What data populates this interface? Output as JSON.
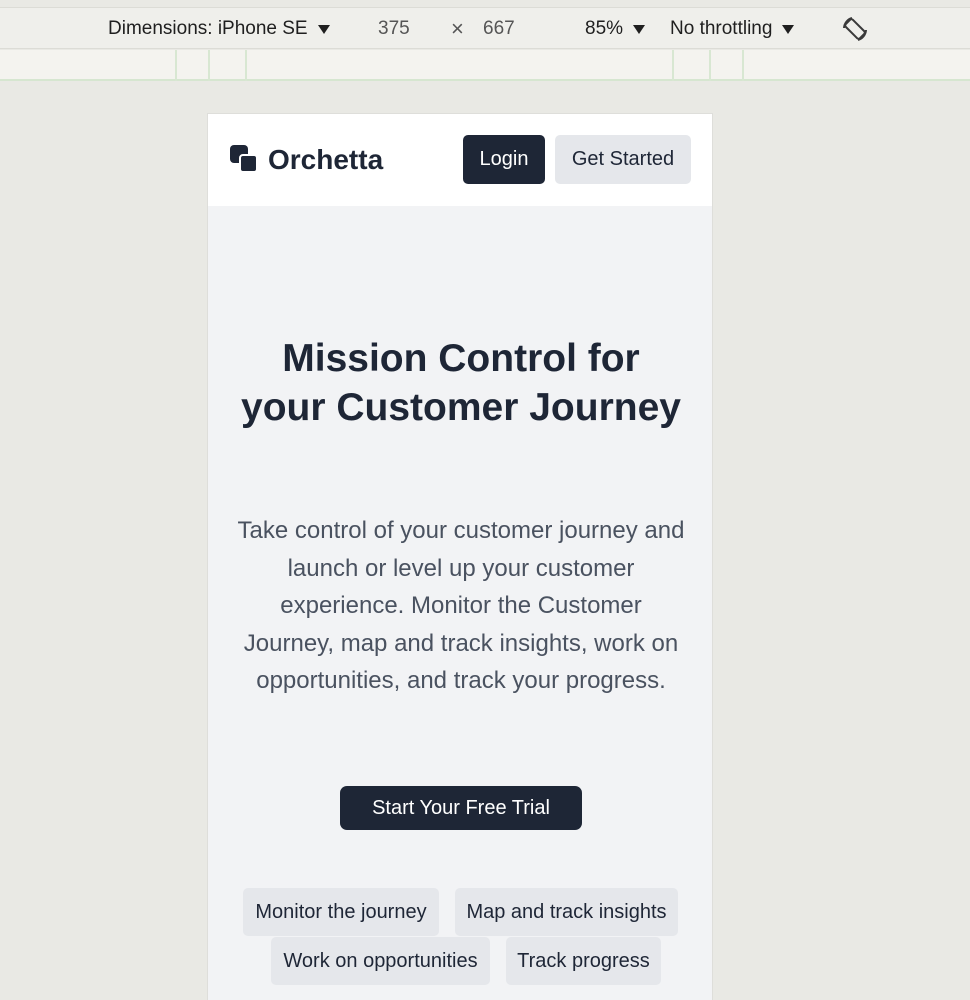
{
  "toolbar": {
    "dimensions_label": "Dimensions: iPhone SE",
    "width": "375",
    "times": "×",
    "height": "667",
    "zoom": "85%",
    "throttling": "No throttling",
    "rotate_icon": "rotate-icon"
  },
  "site": {
    "brand": "Orchetta",
    "logo_icon": "overlapping-squares-logo",
    "login_label": "Login",
    "get_started_label": "Get Started"
  },
  "hero": {
    "title": "Mission Control for your Customer Journey",
    "description": "Take control of your customer journey and launch or level up your customer experience. Monitor the Customer Journey, map and track insights, work on opportunities, and track your progress.",
    "cta_label": "Start Your Free Trial"
  },
  "features": [
    "Monitor the journey",
    "Map and track insights",
    "Work on opportunities",
    "Track progress"
  ],
  "colors": {
    "primary": "#1e2636",
    "secondary_button": "#e5e7eb",
    "page_background": "#f2f3f5"
  }
}
